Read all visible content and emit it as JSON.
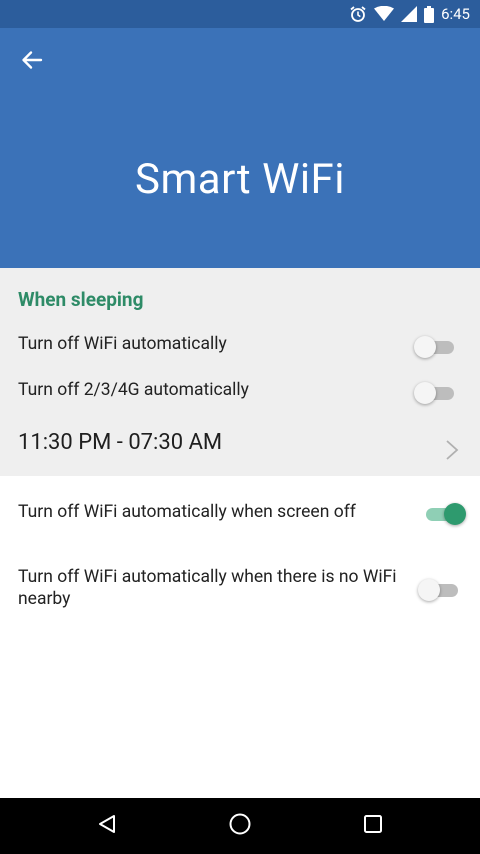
{
  "status_bar": {
    "time": "6:45",
    "icons": [
      "alarm-icon",
      "wifi-icon",
      "signal-icon",
      "battery-icon"
    ]
  },
  "header": {
    "title": "Smart WiFi",
    "back_icon": "arrow-back-icon",
    "background_color": "#3b72b8"
  },
  "sleep_section": {
    "header": "When sleeping",
    "header_color": "#2e8b67",
    "items": [
      {
        "label": "Turn off WiFi automatically",
        "enabled": false
      },
      {
        "label": "Turn off 2/3/4G automatically",
        "enabled": false
      }
    ],
    "schedule": "11:30 PM - 07:30 AM"
  },
  "settings": {
    "items": [
      {
        "label": "Turn off WiFi automatically when screen off",
        "enabled": true
      },
      {
        "label": "Turn off WiFi automatically when there is no WiFi nearby",
        "enabled": false
      }
    ]
  },
  "nav_bar": {
    "buttons": [
      "back-triangle-icon",
      "home-circle-icon",
      "recents-square-icon"
    ]
  },
  "colors": {
    "status_bar": "#2c5d9c",
    "toggle_on": "#2e9a6e",
    "toggle_off": "#bdbdbd"
  }
}
